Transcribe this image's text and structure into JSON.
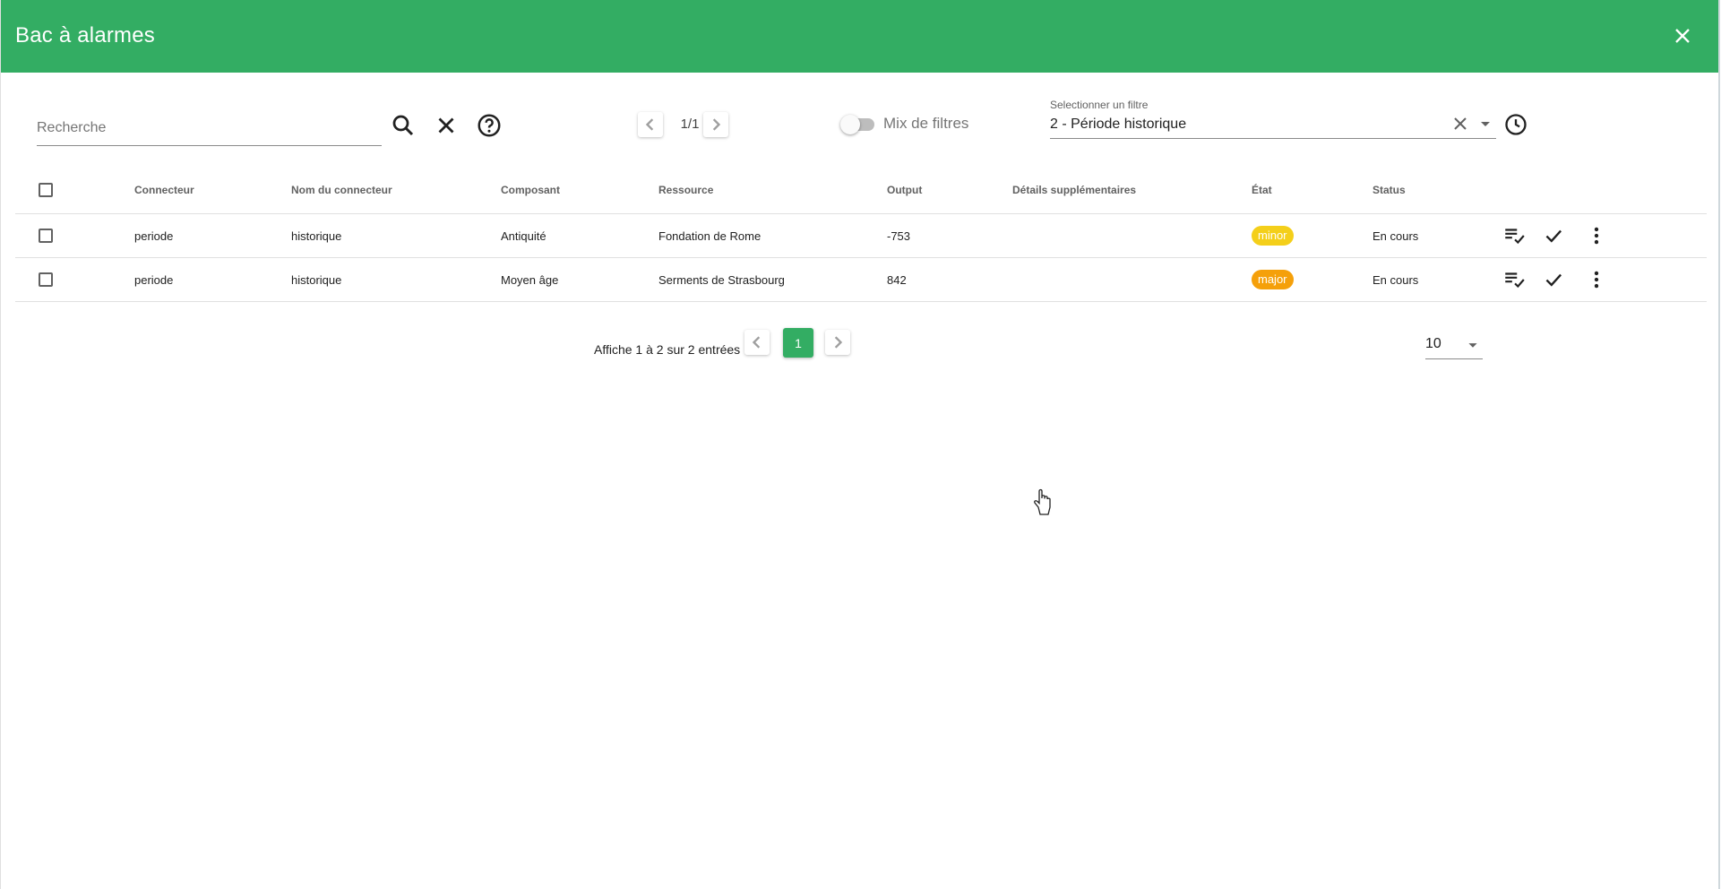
{
  "header": {
    "title": "Bac à alarmes"
  },
  "toolbar": {
    "search_placeholder": "Recherche",
    "pager_label": "1/1",
    "mix_filters_label": "Mix de filtres",
    "filter_caption": "Selectionner un filtre",
    "filter_value": "2 - Période historique"
  },
  "table": {
    "columns": [
      "Connecteur",
      "Nom du connecteur",
      "Composant",
      "Ressource",
      "Output",
      "Détails supplémentaires",
      "État",
      "Status"
    ],
    "rows": [
      {
        "connector": "periode",
        "connector_name": "historique",
        "component": "Antiquité",
        "resource": "Fondation de Rome",
        "output": "-753",
        "details": "",
        "state": "minor",
        "state_color": "#f4cf1a",
        "status": "En cours"
      },
      {
        "connector": "periode",
        "connector_name": "historique",
        "component": "Moyen âge",
        "resource": "Serments de Strasbourg",
        "output": "842",
        "details": "",
        "state": "major",
        "state_color": "#f5a00a",
        "status": "En cours"
      }
    ]
  },
  "pagination": {
    "info": "Affiche 1 à 2 sur 2 entrées",
    "current_page": "1",
    "per_page": "10"
  },
  "colors": {
    "primary": "#33ad63"
  }
}
